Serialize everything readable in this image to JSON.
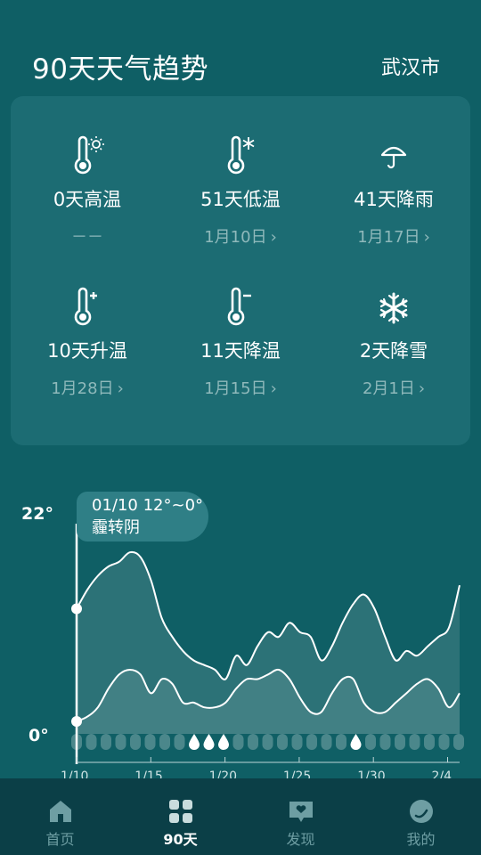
{
  "header": {
    "title": "90天天气趋势",
    "city": "武汉市"
  },
  "stats": [
    {
      "label": "0天高温",
      "sub": "－－",
      "has_link": false
    },
    {
      "label": "51天低温",
      "sub": "1月10日",
      "has_link": true
    },
    {
      "label": "41天降雨",
      "sub": "1月17日",
      "has_link": true
    },
    {
      "label": "10天升温",
      "sub": "1月28日",
      "has_link": true
    },
    {
      "label": "11天降温",
      "sub": "1月15日",
      "has_link": true
    },
    {
      "label": "2天降雪",
      "sub": "2月1日",
      "has_link": true
    }
  ],
  "chart": {
    "y_max_label": "22°",
    "y_min_label": "0°",
    "tooltip_line1": "01/10 12°~0°",
    "tooltip_line2": "霾转阴",
    "x_labels": [
      "1/10",
      "1/15",
      "1/20",
      "1/25",
      "1/30",
      "2/4"
    ]
  },
  "chart_data": {
    "type": "area",
    "ylim": [
      0,
      22
    ],
    "series": [
      {
        "values": [
          12,
          14,
          15.5,
          16.5,
          17,
          18,
          17.5,
          15,
          11,
          9,
          7.5,
          6.5,
          6,
          5.5,
          4.5,
          7,
          6,
          8,
          9.5,
          9,
          10.5,
          9.5,
          9,
          6.5,
          8,
          10.5,
          12.5,
          13.5,
          12,
          9,
          6.5,
          7.5,
          7,
          8,
          9,
          10,
          14.5
        ]
      },
      {
        "values": [
          0,
          0.5,
          1.5,
          3.5,
          5,
          5.5,
          5,
          3,
          4.5,
          4,
          2,
          2,
          1.5,
          1.5,
          2,
          3.5,
          4.5,
          4.5,
          5,
          5.5,
          4.5,
          2.5,
          1,
          1,
          3,
          4.5,
          4.5,
          2,
          1,
          1,
          2,
          3,
          4,
          4.5,
          3.5,
          1.5,
          3
        ]
      }
    ],
    "icons": [
      "cloud",
      "cloud",
      "cloud",
      "cloud",
      "cloud",
      "cloud",
      "cloud",
      "cloud",
      "rain",
      "rain",
      "rain",
      "cloud",
      "cloud",
      "cloud",
      "cloud",
      "cloud",
      "cloud",
      "cloud",
      "cloud",
      "rain",
      "cloud",
      "cloud",
      "cloud",
      "cloud",
      "cloud",
      "cloud",
      "cloud",
      "cloud",
      "cloud",
      "cloud",
      "cloud",
      "cloud",
      "rain",
      "cloud",
      "cloud",
      "cloud",
      "snow",
      "cloud"
    ]
  },
  "tabs": [
    {
      "label": "首页",
      "icon": "home-icon",
      "active": false
    },
    {
      "label": "90天",
      "icon": "grid-icon",
      "active": true
    },
    {
      "label": "发现",
      "icon": "discover-icon",
      "active": false
    },
    {
      "label": "我的",
      "icon": "profile-icon",
      "active": false
    }
  ],
  "colors": {
    "background": "#0f5f65",
    "card": "#1c6c73",
    "tabbar": "#0b3f47"
  }
}
